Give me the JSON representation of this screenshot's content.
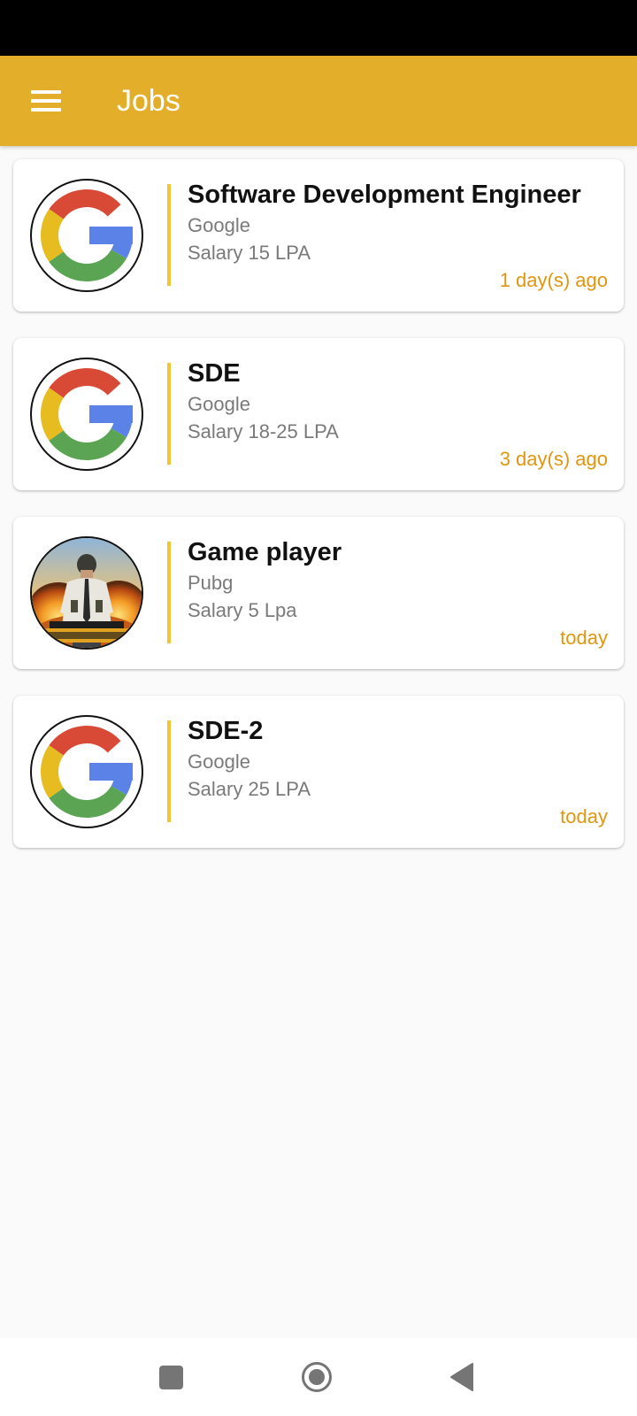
{
  "app_bar": {
    "title": "Jobs",
    "color": "#e3ae29",
    "menu_icon": "hamburger-menu-icon"
  },
  "jobs": [
    {
      "title": "Software Development Engineer",
      "company": "Google",
      "salary": "Salary 15 LPA",
      "posted": "1 day(s) ago",
      "logo": "google-logo-icon"
    },
    {
      "title": "SDE",
      "company": "Google",
      "salary": "Salary 18-25 LPA",
      "posted": "3 day(s) ago",
      "logo": "google-logo-icon"
    },
    {
      "title": "Game player",
      "company": "Pubg",
      "salary": "Salary 5 Lpa",
      "posted": "today",
      "logo": "pubg-logo-icon"
    },
    {
      "title": "SDE-2",
      "company": "Google",
      "salary": "Salary 25 LPA",
      "posted": "today",
      "logo": "google-logo-icon"
    }
  ],
  "colors": {
    "accent_divider": "#f3c433",
    "posted_text": "#e0960e",
    "secondary_text": "#7a7a7a"
  },
  "nav_bar": {
    "icons": [
      "recent-apps-icon",
      "home-icon",
      "back-icon"
    ]
  }
}
